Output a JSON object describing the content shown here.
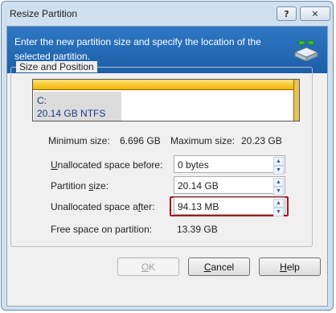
{
  "window": {
    "title": "Resize Partition",
    "help_glyph": "?",
    "close_glyph": "✕"
  },
  "header": {
    "text": "Enter the new partition size and specify the location of the selected partition.",
    "icon": "drive-resize-icon"
  },
  "group": {
    "legend": "Size and Position"
  },
  "partition": {
    "letter": "C:",
    "size_fs": "20.14 GB  NTFS",
    "used_fraction": 0.33
  },
  "limits": {
    "min_label": "Minimum size:",
    "min_value": "6.696 GB",
    "max_label": "Maximum size:",
    "max_value": "20.23 GB"
  },
  "fields": [
    {
      "label_pre": "",
      "label_u": "U",
      "label_post": "nallocated space before:",
      "value": "0 bytes"
    },
    {
      "label_pre": "Partition ",
      "label_u": "s",
      "label_post": "ize:",
      "value": "20.14 GB"
    },
    {
      "label_pre": "Unallocated space a",
      "label_u": "f",
      "label_post": "ter:",
      "value": "94.13 MB"
    }
  ],
  "free": {
    "label": "Free space on partition:",
    "value": "13.39 GB"
  },
  "buttons": {
    "ok_u": "O",
    "ok_rest": "K",
    "cancel_u": "C",
    "cancel_rest": "ancel",
    "help_u": "H",
    "help_rest": "elp"
  },
  "colors": {
    "header_bg": "#2f78c4",
    "bar_fill": "#f3b400",
    "highlight": "#a4161a"
  }
}
